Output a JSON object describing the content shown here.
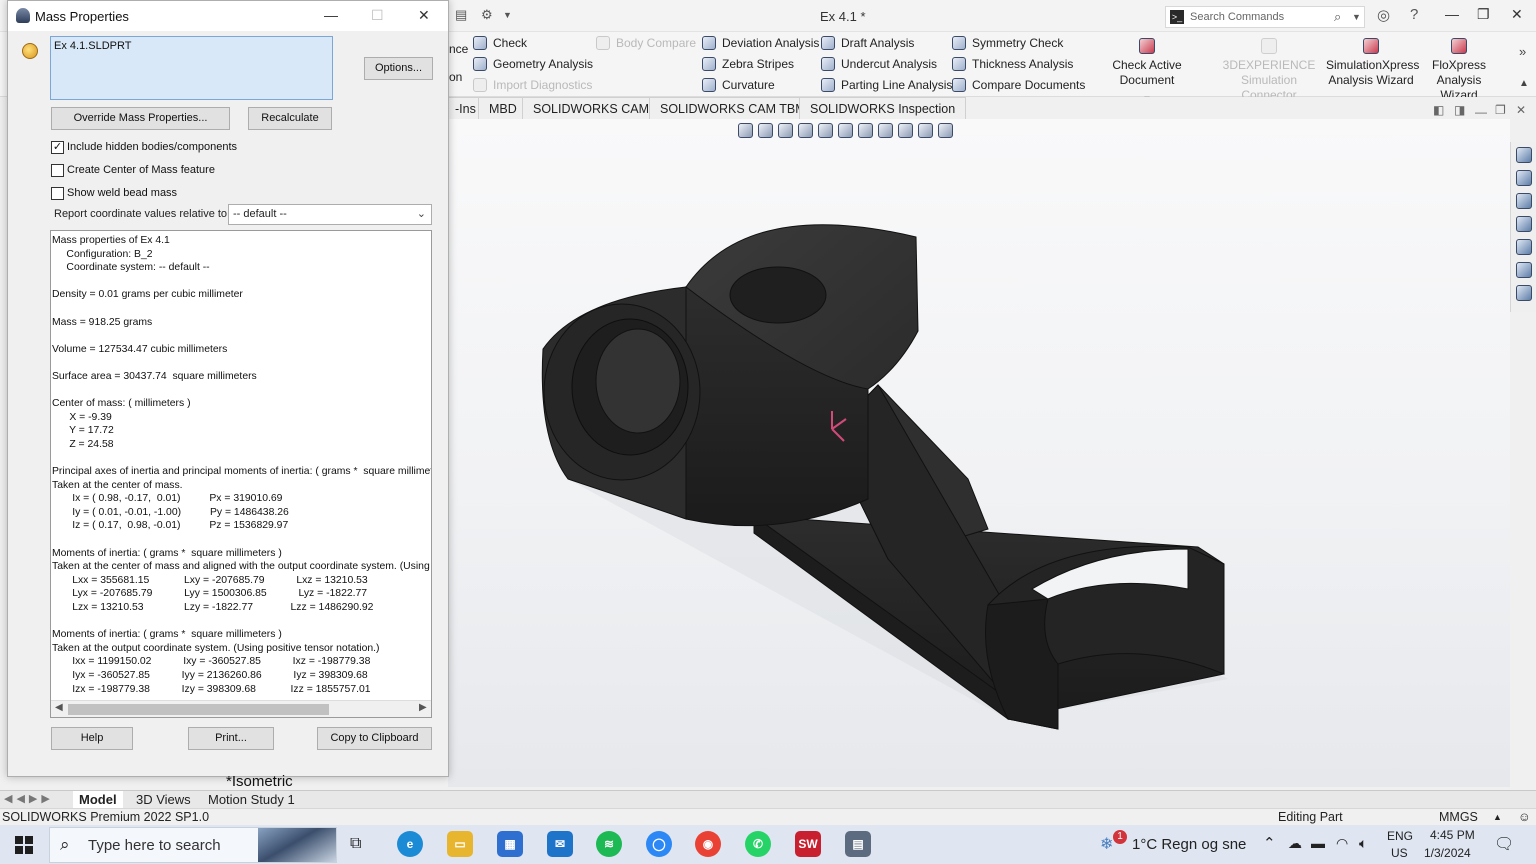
{
  "window": {
    "title": "Ex 4.1 *",
    "search_placeholder": "Search Commands"
  },
  "ribbon": {
    "partial_left_1": "nce",
    "partial_left_2": "on",
    "col1": [
      "Check",
      "Geometry Analysis",
      "Import Diagnostics"
    ],
    "body_compare": "Body Compare",
    "col2": [
      "Deviation Analysis",
      "Zebra Stripes",
      "Curvature"
    ],
    "col3": [
      "Draft Analysis",
      "Undercut Analysis",
      "Parting Line Analysis"
    ],
    "col4": [
      "Symmetry Check",
      "Thickness Analysis",
      "Compare Documents"
    ],
    "check_active": "Check Active Document",
    "sim_connector_1": "3DEXPERIENCE",
    "sim_connector_2": "Simulation Connector",
    "simx_1": "SimulationXpress",
    "simx_2": "Analysis Wizard",
    "flox_1": "FloXpress",
    "flox_2": "Analysis Wizard"
  },
  "cm_tabs": [
    "-Ins",
    "MBD",
    "SOLIDWORKS CAM",
    "SOLIDWORKS CAM TBM",
    "SOLIDWORKS Inspection"
  ],
  "dialog": {
    "title": "Mass Properties",
    "selection": "Ex 4.1.SLDPRT",
    "options": "Options...",
    "override": "Override Mass Properties...",
    "recalculate": "Recalculate",
    "chk_hidden": "Include hidden bodies/components",
    "chk_hidden_checked": true,
    "chk_com": "Create Center of Mass feature",
    "chk_weld": "Show weld bead mass",
    "relative_label": "Report coordinate values relative to:",
    "relative_value": "-- default --",
    "results": [
      "Mass properties of Ex 4.1",
      "     Configuration: B_2",
      "     Coordinate system: -- default --",
      "",
      "Density = 0.01 grams per cubic millimeter",
      "",
      "Mass = 918.25 grams",
      "",
      "Volume = 127534.47 cubic millimeters",
      "",
      "Surface area = 30437.74  square millimeters",
      "",
      "Center of mass: ( millimeters )",
      "      X = -9.39",
      "      Y = 17.72",
      "      Z = 24.58",
      "",
      "Principal axes of inertia and principal moments of inertia: ( grams *  square millimeters )",
      "Taken at the center of mass.",
      "       Ix = ( 0.98, -0.17,  0.01)          Px = 319010.69",
      "       Iy = ( 0.01, -0.01, -1.00)          Py = 1486438.26",
      "       Iz = ( 0.17,  0.98, -0.01)          Pz = 1536829.97",
      "",
      "Moments of inertia: ( grams *  square millimeters )",
      "Taken at the center of mass and aligned with the output coordinate system. (Using positive tensor notation.)",
      "       Lxx = 355681.15            Lxy = -207685.79           Lxz = 13210.53",
      "       Lyx = -207685.79           Lyy = 1500306.85           Lyz = -1822.77",
      "       Lzx = 13210.53              Lzy = -1822.77             Lzz = 1486290.92",
      "",
      "Moments of inertia: ( grams *  square millimeters )",
      "Taken at the output coordinate system. (Using positive tensor notation.)",
      "       Ixx = 1199150.02           Ixy = -360527.85           Ixz = -198779.38",
      "       Iyx = -360527.85           Iyy = 2136260.86           Iyz = 398309.68",
      "       Izx = -198779.38           Izy = 398309.68            Izz = 1855757.01"
    ],
    "help": "Help",
    "print": "Print...",
    "copy": "Copy to Clipboard"
  },
  "view_label": "*Isometric",
  "bottom_tabs": [
    "Model",
    "3D Views",
    "Motion Study 1"
  ],
  "status": {
    "left": "SOLIDWORKS Premium 2022 SP1.0",
    "mode": "Editing Part",
    "units": "MMGS"
  },
  "taskbar": {
    "search": "Type here to search",
    "weather_badge": "1",
    "weather": "1°C  Regn og sne",
    "lang_1": "ENG",
    "lang_2": "US",
    "time": "4:45 PM",
    "date": "1/3/2024"
  }
}
